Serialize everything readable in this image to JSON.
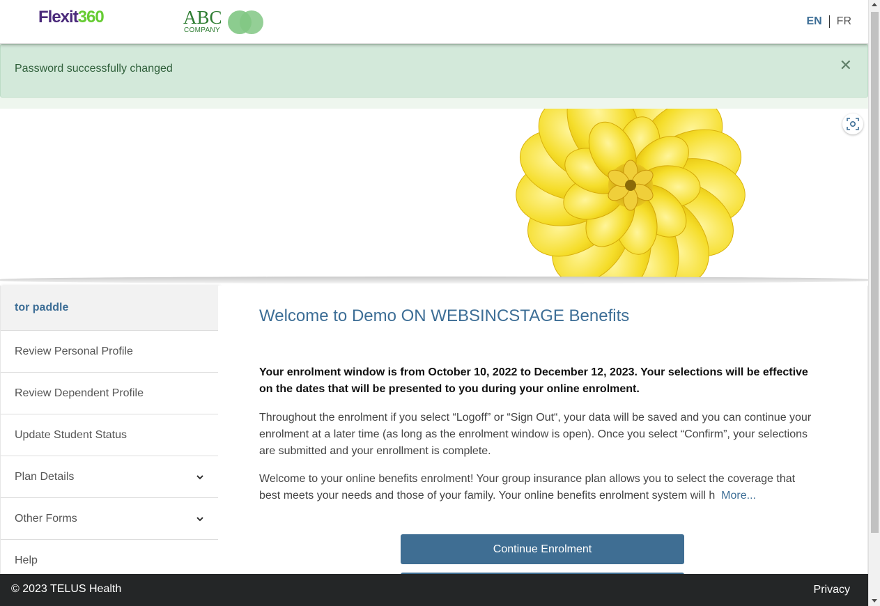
{
  "header": {
    "logo_flexit_part1": "Flexit",
    "logo_flexit_part2": "360",
    "logo_company_name": "ABC",
    "logo_company_sub": "COMPANY",
    "lang_en": "EN",
    "lang_fr": "FR"
  },
  "alert": {
    "message": "Password successfully changed",
    "close_glyph": "✕"
  },
  "sidebar": {
    "user_name": "tor paddle",
    "items": [
      {
        "label": "Review Personal Profile",
        "has_chevron": false
      },
      {
        "label": "Review Dependent Profile",
        "has_chevron": false
      },
      {
        "label": "Update Student Status",
        "has_chevron": false
      },
      {
        "label": "Plan Details",
        "has_chevron": true
      },
      {
        "label": "Other Forms",
        "has_chevron": true
      },
      {
        "label": "Help",
        "has_chevron": false
      }
    ]
  },
  "main": {
    "title": "Welcome to Demo ON WEBSINCSTAGE Benefits",
    "enrolment_window": "Your enrolment window is from October 10, 2022 to December 12, 2023. Your selections will be effective on the dates that will be presented to you during your online enrolment.",
    "paragraph1": "Throughout the enrolment if you select “Logoff” or “Sign Out“, your data will be saved and you can continue your enrolment at a later time (as long as the enrolment window is open). Once you select “Confirm”, your selections are submitted and your enrollment is complete.",
    "paragraph2": "Welcome to your online benefits enrolment! Your group insurance plan allows you to select the coverage that best meets your needs and those of your family. Your online benefits enrolment system will h",
    "more_link": "More...",
    "continue_button": "Continue Enrolment"
  },
  "footer": {
    "copyright": "© 2023 TELUS Health",
    "privacy": "Privacy"
  },
  "colors": {
    "accent": "#3d6e96",
    "button": "#3f6e93",
    "alert_bg": "#d3e9da",
    "footer_bg": "#242627"
  }
}
